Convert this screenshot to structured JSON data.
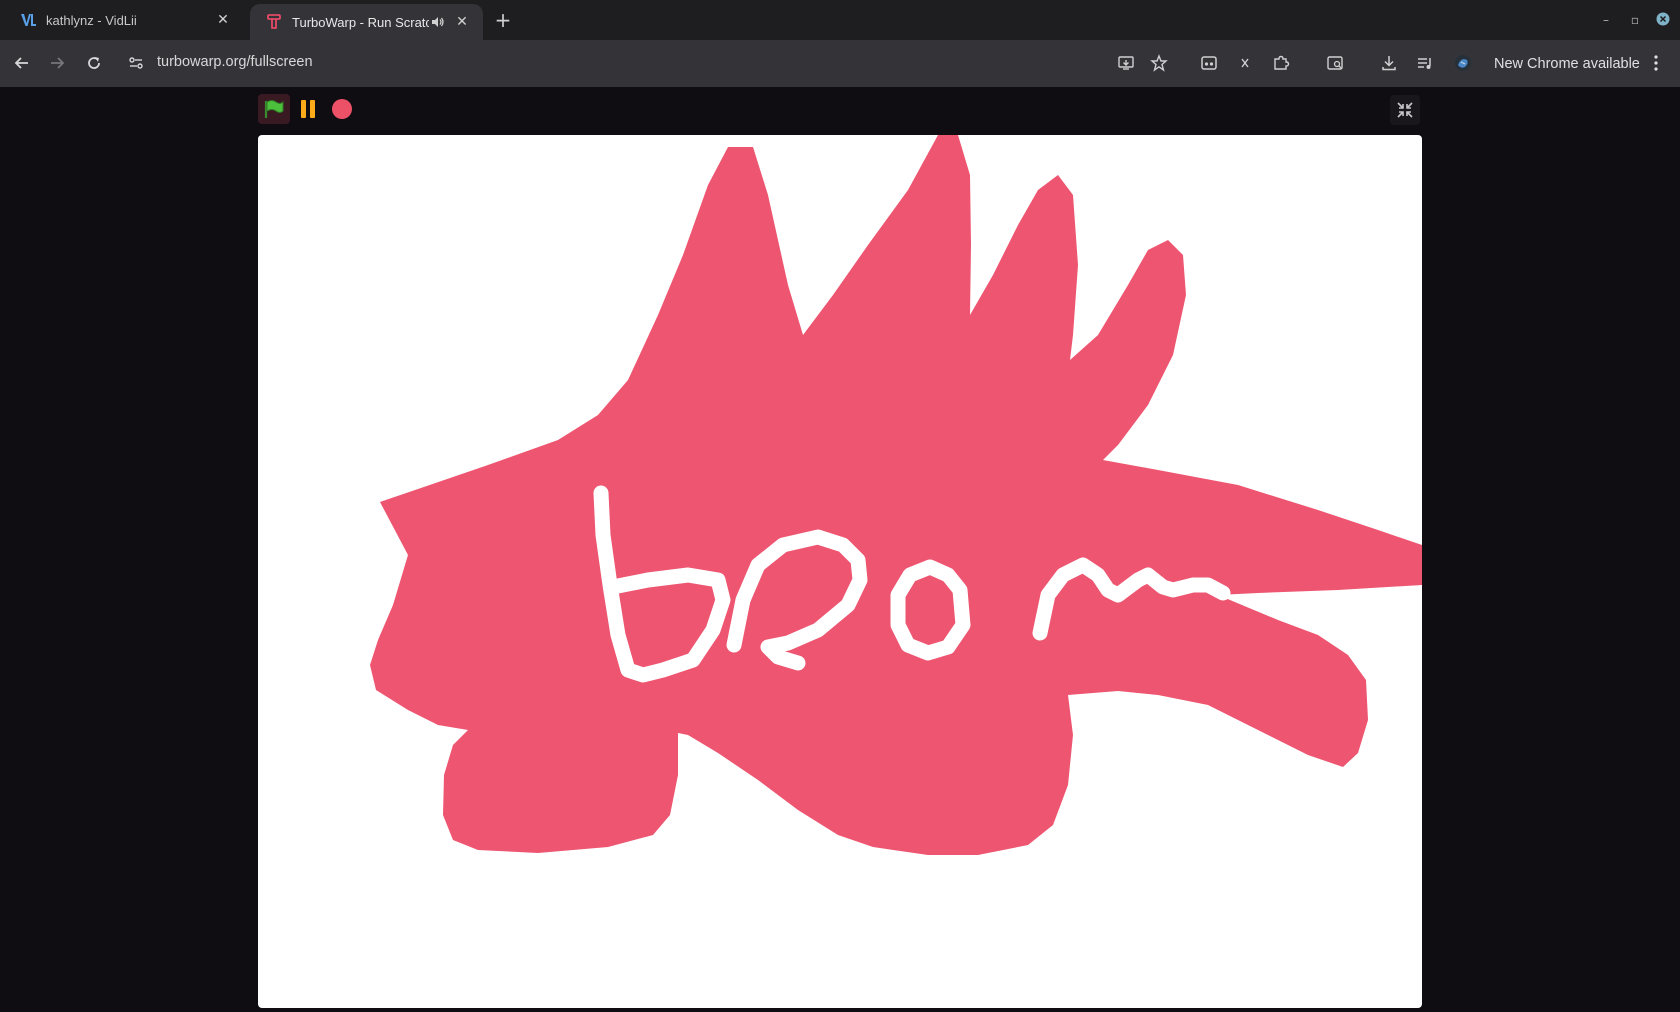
{
  "tabs": [
    {
      "title": "kathlynz - VidLii",
      "active": false
    },
    {
      "title": "TurboWarp - Run Scratch",
      "active": true
    }
  ],
  "toolbar": {
    "url": "turbowarp.org/fullscreen",
    "update_label": "New Chrome available"
  },
  "player": {
    "stage_background": "#ffffff",
    "drawing_color": "#ee5570",
    "stroke_color": "#ffffff"
  },
  "colors": {
    "tabstrip": "#1e1e20",
    "toolbar": "#343438",
    "page": "#0f0c12"
  }
}
